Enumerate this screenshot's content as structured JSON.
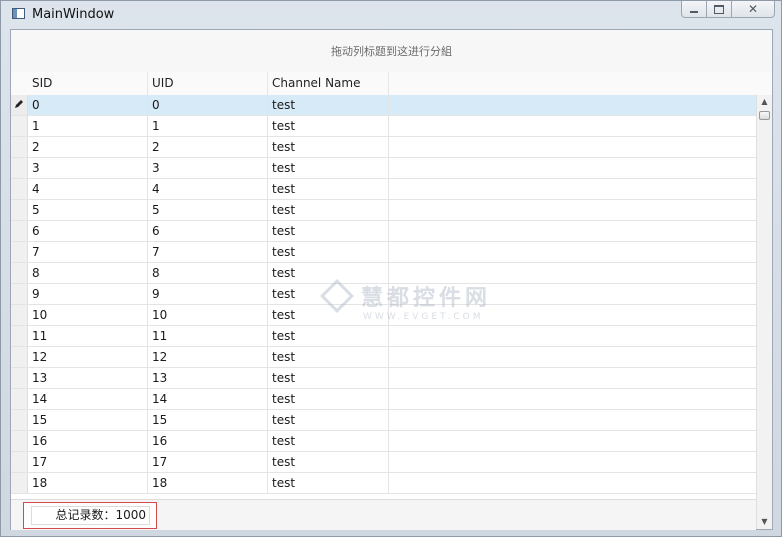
{
  "window": {
    "title": "MainWindow",
    "buttons": {
      "minimize": "minimize-icon",
      "maximize": "maximize-icon",
      "close": "close-icon"
    }
  },
  "grid": {
    "group_panel_text": "拖动列标题到这进行分組",
    "columns": [
      "SID",
      "UID",
      "Channel Name"
    ],
    "rows": [
      [
        "0",
        "0",
        "test"
      ],
      [
        "1",
        "1",
        "test"
      ],
      [
        "2",
        "2",
        "test"
      ],
      [
        "3",
        "3",
        "test"
      ],
      [
        "4",
        "4",
        "test"
      ],
      [
        "5",
        "5",
        "test"
      ],
      [
        "6",
        "6",
        "test"
      ],
      [
        "7",
        "7",
        "test"
      ],
      [
        "8",
        "8",
        "test"
      ],
      [
        "9",
        "9",
        "test"
      ],
      [
        "10",
        "10",
        "test"
      ],
      [
        "11",
        "11",
        "test"
      ],
      [
        "12",
        "12",
        "test"
      ],
      [
        "13",
        "13",
        "test"
      ],
      [
        "14",
        "14",
        "test"
      ],
      [
        "15",
        "15",
        "test"
      ],
      [
        "16",
        "16",
        "test"
      ],
      [
        "17",
        "17",
        "test"
      ],
      [
        "18",
        "18",
        "test"
      ]
    ],
    "selected_row": 0,
    "summary_text": "总记录数：1000"
  },
  "watermark": {
    "main": "慧都控件网",
    "sub": "WWW.EVGET.COM"
  },
  "colors": {
    "selected_row": "#d6eaf8",
    "summary_border": "#d24a4a"
  }
}
